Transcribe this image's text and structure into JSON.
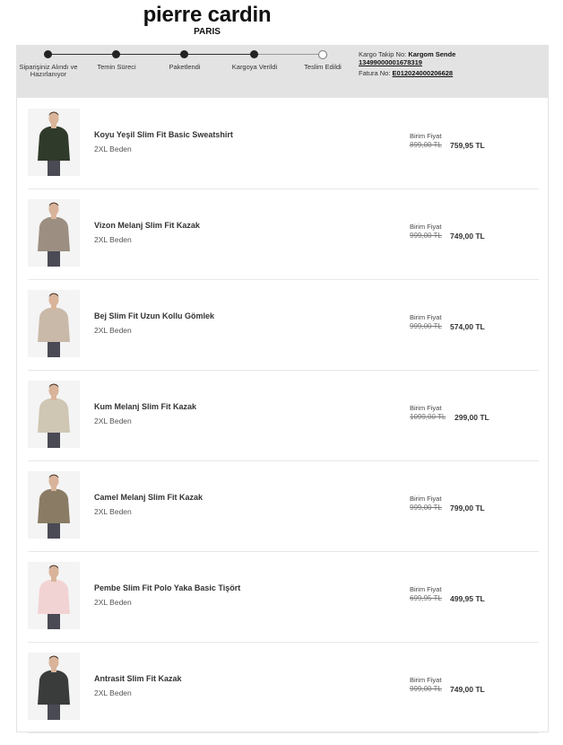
{
  "brand": {
    "name": "pierre cardin",
    "sub": "PARIS"
  },
  "status": {
    "steps": [
      {
        "label": "Siparişiniz Alındı ve Hazırlanıyor",
        "done": true
      },
      {
        "label": "Temin Süreci",
        "done": true
      },
      {
        "label": "Paketlendi",
        "done": true
      },
      {
        "label": "Kargoya Verildi",
        "done": true
      },
      {
        "label": "Teslim Edildi",
        "done": false
      }
    ],
    "cargo_label": "Kargo Takip No:",
    "cargo_company": "Kargom Sende",
    "cargo_number": "13499000001678319",
    "invoice_label": "Fatura No:",
    "invoice_number": "E012024000206628"
  },
  "products": [
    {
      "name": "Koyu Yeşil Slim Fit Basic Sweatshirt",
      "size": "2XL Beden",
      "price_label": "Birim Fiyat",
      "old_price": "899,00 TL",
      "new_price": "759,95 TL",
      "color": "#2f3a2a"
    },
    {
      "name": "Vizon Melanj Slim Fit Kazak",
      "size": "2XL Beden",
      "price_label": "Birim Fiyat",
      "old_price": "999,00 TL",
      "new_price": "749,00 TL",
      "color": "#9c8f82"
    },
    {
      "name": "Bej Slim Fit Uzun Kollu Gömlek",
      "size": "2XL Beden",
      "price_label": "Birim Fiyat",
      "old_price": "999,00 TL",
      "new_price": "574,00 TL",
      "color": "#c9b9a9"
    },
    {
      "name": "Kum Melanj Slim Fit Kazak",
      "size": "2XL Beden",
      "price_label": "Birim Fiyat",
      "old_price": "1099,00 TL",
      "new_price": "299,00 TL",
      "color": "#cfc6b3"
    },
    {
      "name": "Camel Melanj Slim Fit Kazak",
      "size": "2XL Beden",
      "price_label": "Birim Fiyat",
      "old_price": "999,00 TL",
      "new_price": "799,00 TL",
      "color": "#8a7c64"
    },
    {
      "name": "Pembe Slim Fit Polo Yaka Basic Tişört",
      "size": "2XL Beden",
      "price_label": "Birim Fiyat",
      "old_price": "699,95 TL",
      "new_price": "499,95 TL",
      "color": "#f2d3d3"
    },
    {
      "name": "Antrasit Slim Fit Kazak",
      "size": "2XL Beden",
      "price_label": "Birim Fiyat",
      "old_price": "999,00 TL",
      "new_price": "749,00 TL",
      "color": "#3a3c3c"
    }
  ]
}
